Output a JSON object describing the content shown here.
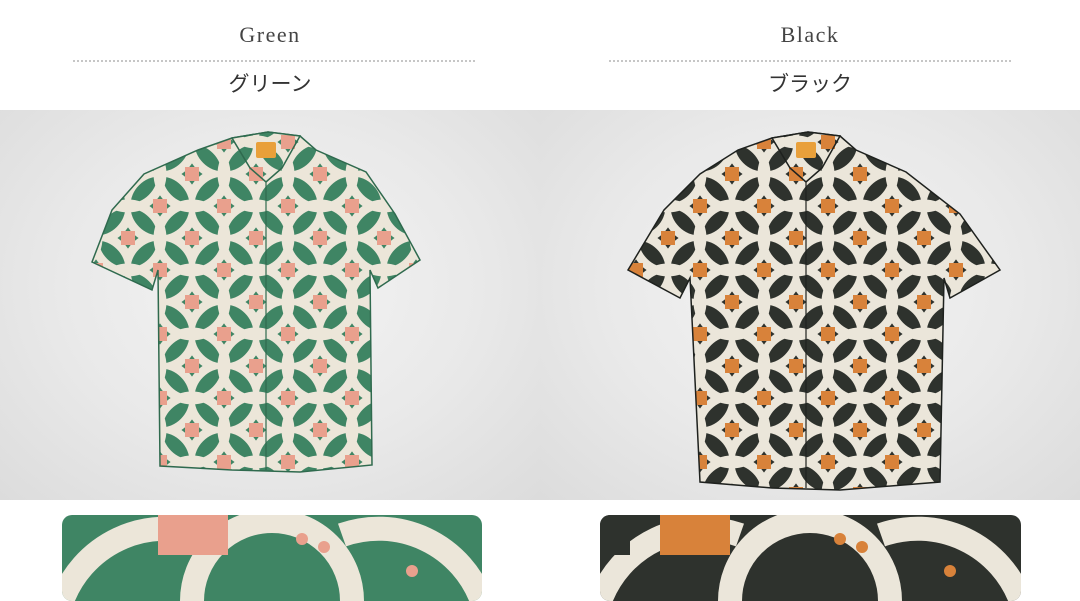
{
  "variants": [
    {
      "name_en": "Green",
      "name_jp": "グリーン",
      "colors": {
        "ground": "#3f8564",
        "motif": "#ece6d9",
        "accent": "#e9a08d",
        "collar_tag": "#e9a03a"
      }
    },
    {
      "name_en": "Black",
      "name_jp": "ブラック",
      "colors": {
        "ground": "#2e322d",
        "motif": "#ebe6da",
        "accent": "#d8823a",
        "collar_tag": "#e9a03a"
      }
    }
  ]
}
